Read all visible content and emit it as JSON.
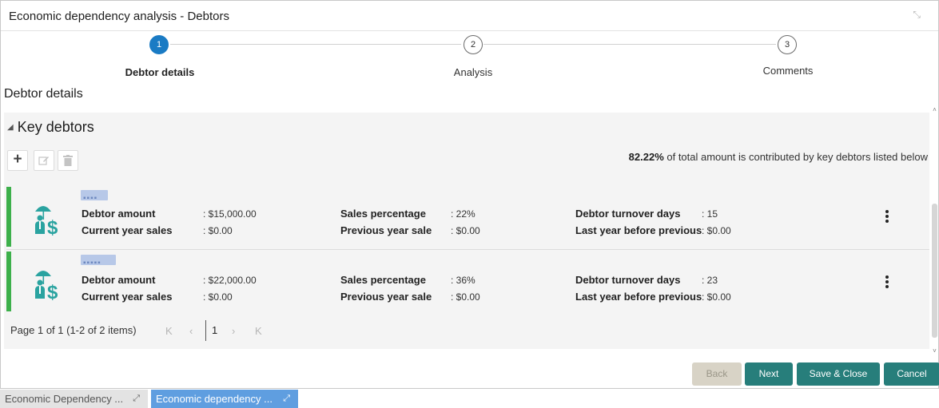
{
  "window": {
    "title": "Economic dependency analysis - Debtors",
    "maximize_icon": "expand-arrows-icon"
  },
  "stepper": {
    "steps": [
      {
        "number": "1",
        "label": "Debtor details",
        "active": true
      },
      {
        "number": "2",
        "label": "Analysis",
        "active": false
      },
      {
        "number": "3",
        "label": "Comments",
        "active": false
      }
    ]
  },
  "section": {
    "title": "Debtor details"
  },
  "key_debtors": {
    "header": "Key debtors",
    "toolbar": {
      "add_icon": "plus-icon",
      "edit_icon": "edit-icon",
      "delete_icon": "trash-icon"
    },
    "contribution": {
      "percent": "82.22%",
      "text": " of total amount is contributed by key debtors listed below"
    },
    "cards": [
      {
        "name": "▪▪▪▪",
        "debtor_amount_label": "Debtor amount",
        "debtor_amount": ": $15,000.00",
        "current_sales_label": "Current year sales",
        "current_sales": ": $0.00",
        "sales_pct_label": "Sales percentage",
        "sales_pct": ":  22%",
        "prev_sale_label": "Previous year sale",
        "prev_sale": ":  $0.00",
        "turnover_label": "Debtor turnover days",
        "turnover": ":  15",
        "last_year_label": "Last year before previous",
        "last_year": ":  $0.00"
      },
      {
        "name": "▪▪▪▪▪",
        "debtor_amount_label": "Debtor amount",
        "debtor_amount": ": $22,000.00",
        "current_sales_label": "Current year sales",
        "current_sales": ": $0.00",
        "sales_pct_label": "Sales percentage",
        "sales_pct": ":  36%",
        "prev_sale_label": "Previous year sale",
        "prev_sale": ":  $0.00",
        "turnover_label": "Debtor turnover days",
        "turnover": ":  23",
        "last_year_label": "Last year before previous",
        "last_year": ":  $0.00"
      }
    ],
    "pagination": {
      "text": "Page  1  of 1   (1-2 of 2 items)",
      "current_page": "1"
    }
  },
  "actions": {
    "back": "Back",
    "next": "Next",
    "save_close": "Save & Close",
    "cancel": "Cancel"
  },
  "taskbar": [
    {
      "label": "Economic Dependency ..."
    },
    {
      "label": "Economic dependency ..."
    }
  ],
  "colors": {
    "accent": "#277e7b",
    "step_active": "#1a7bc4",
    "card_bar": "#3db04b",
    "icon": "#2aa3a0"
  }
}
